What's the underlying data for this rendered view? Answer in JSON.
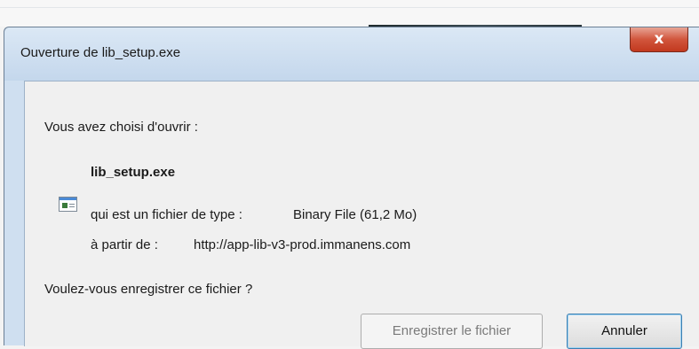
{
  "dialog": {
    "title": "Ouverture de lib_setup.exe",
    "close_label": "x",
    "intro": "Vous avez choisi d'ouvrir :",
    "file_name": "lib_setup.exe",
    "type_prefix": "qui est un fichier de type :",
    "type_value": "Binary File (61,2 Mo)",
    "from_prefix": "à partir de :",
    "from_value": "http://app-lib-v3-prod.immanens.com",
    "question": "Voulez-vous enregistrer ce fichier ?",
    "save_label": "Enregistrer le fichier",
    "cancel_label": "Annuler"
  }
}
